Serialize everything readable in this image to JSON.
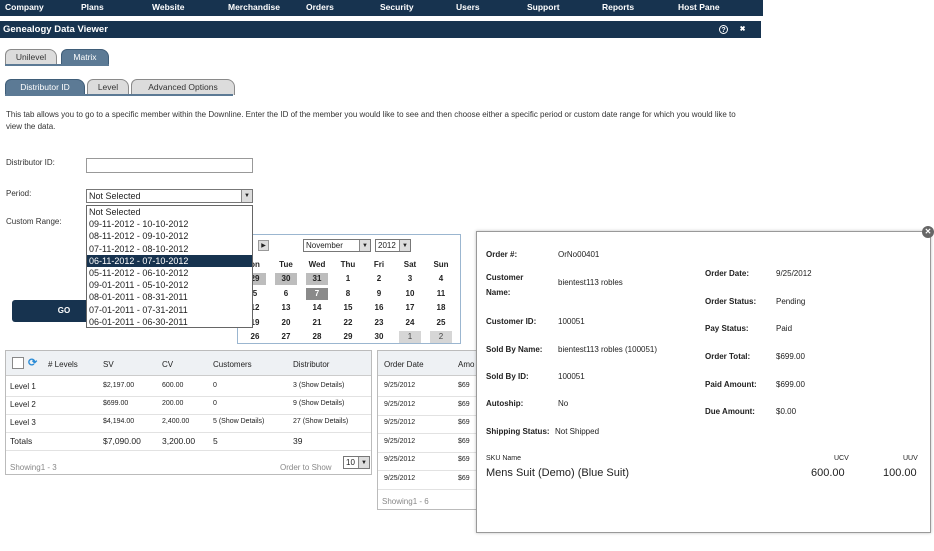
{
  "nav": [
    "Company",
    "Plans",
    "Website",
    "Merchandise",
    "Orders",
    "Security",
    "Users",
    "Support",
    "Reports",
    "Host Pane"
  ],
  "window": {
    "title": "Genealogy Data Viewer",
    "help_icon": "?",
    "close_icon": "✖"
  },
  "tree_tabs": [
    "Unilevel",
    "Matrix"
  ],
  "sub_tabs": [
    "Distributor ID",
    "Level",
    "Advanced Options"
  ],
  "description": "This tab allows you to go to a specific member within the Downline. Enter the ID of the member you would like to see and then choose either a specific period or custom date range for which you would like to view the data.",
  "form": {
    "distributor_label": "Distributor ID:",
    "distributor_value": "",
    "period_label": "Period:",
    "period_selected": "Not Selected",
    "custom_range_label": "Custom Range:",
    "go_label": "GO"
  },
  "period_options": [
    "Not Selected",
    "09-11-2012 - 10-10-2012",
    "08-11-2012 - 09-10-2012",
    "07-11-2012 - 08-10-2012",
    "06-11-2012 - 07-10-2012",
    "05-11-2012 - 06-10-2012",
    "09-01-2011 - 05-10-2012",
    "08-01-2011 - 08-31-2011",
    "07-01-2011 - 07-31-2011",
    "06-01-2011 - 06-30-2011"
  ],
  "calendar": {
    "month": "November",
    "year": "2012",
    "nav_next": "▶",
    "days": [
      "on",
      "Tue",
      "Wed",
      "Thu",
      "Fri",
      "Sat",
      "Sun"
    ],
    "weeks": [
      [
        "29",
        "30",
        "31",
        "1",
        "2",
        "3",
        "4"
      ],
      [
        "5",
        "6",
        "7",
        "8",
        "9",
        "10",
        "11"
      ],
      [
        "12",
        "13",
        "14",
        "15",
        "16",
        "17",
        "18"
      ],
      [
        "19",
        "20",
        "21",
        "22",
        "23",
        "24",
        "25"
      ],
      [
        "26",
        "27",
        "28",
        "29",
        "30",
        "1",
        "2"
      ]
    ]
  },
  "levels_table": {
    "headers": [
      "# Levels",
      "SV",
      "CV",
      "Customers",
      "Distributor"
    ],
    "rows": [
      [
        "Level 1",
        "$2,197.00",
        "600.00",
        "0",
        "3 (Show Details)"
      ],
      [
        "Level 2",
        "$699.00",
        "200.00",
        "0",
        "9 (Show Details)"
      ],
      [
        "Level 3",
        "$4,194.00",
        "2,400.00",
        "5 (Show Details)",
        "27 (Show Details)"
      ]
    ],
    "totals": [
      "Totals",
      "$7,090.00",
      "3,200.00",
      "5",
      "39"
    ],
    "showing": "Showing1 - 3",
    "order_label": "Order to Show",
    "order_value": "10"
  },
  "orders_table": {
    "headers": [
      "Order Date",
      "Amo"
    ],
    "rows": [
      [
        "9/25/2012",
        "$69"
      ],
      [
        "9/25/2012",
        "$69"
      ],
      [
        "9/25/2012",
        "$69"
      ],
      [
        "9/25/2012",
        "$69"
      ],
      [
        "9/25/2012",
        "$69"
      ],
      [
        "9/25/2012",
        "$69"
      ]
    ],
    "showing": "Showing1 - 6"
  },
  "order_detail": {
    "order_no_label": "Order #:",
    "order_no": "OrNo00401",
    "customer_label_1": "Customer",
    "customer_label_2": "Name:",
    "customer": "bientest113 robles",
    "customer_id_label": "Customer ID:",
    "customer_id": "100051",
    "sold_by_label": "Sold By Name:",
    "sold_by": "bientest113 robles (100051)",
    "sold_by_id_label": "Sold By ID:",
    "sold_by_id": "100051",
    "autoship_label": "Autoship:",
    "autoship": "No",
    "shipping_label": "Shipping Status:",
    "shipping": "Not Shipped",
    "order_date_label": "Order Date:",
    "order_date": "9/25/2012",
    "order_status_label": "Order Status:",
    "order_status": "Pending",
    "pay_status_label": "Pay Status:",
    "pay_status": "Paid",
    "order_total_label": "Order Total:",
    "order_total": "$699.00",
    "paid_amount_label": "Paid Amount:",
    "paid_amount": "$699.00",
    "due_amount_label": "Due Amount:",
    "due_amount": "$0.00",
    "sku_header": "SKU Name",
    "ucv_header": "UCV",
    "uuv_header": "UUV",
    "sku": "Mens Suit (Demo) (Blue Suit)",
    "ucv": "600.00",
    "uuv": "100.00",
    "close_icon": "✕"
  }
}
